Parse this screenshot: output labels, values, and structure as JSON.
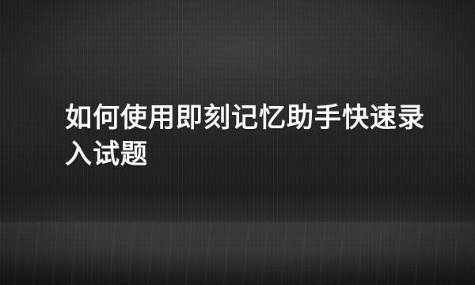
{
  "cover": {
    "title": "如何使用即刻记忆助手快速录入试题"
  }
}
